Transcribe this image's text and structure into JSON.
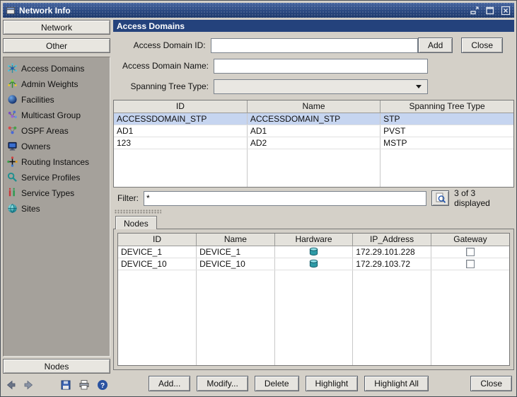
{
  "window": {
    "title": "Network Info"
  },
  "sidebar": {
    "network_button": "Network",
    "other_button": "Other",
    "items": [
      {
        "label": "Access Domains"
      },
      {
        "label": "Admin Weights"
      },
      {
        "label": "Facilities"
      },
      {
        "label": "Multicast Group"
      },
      {
        "label": "OSPF Areas"
      },
      {
        "label": "Owners"
      },
      {
        "label": "Routing Instances"
      },
      {
        "label": "Service Profiles"
      },
      {
        "label": "Service Types"
      },
      {
        "label": "Sites"
      }
    ],
    "nodes_button": "Nodes"
  },
  "header": {
    "title": "Access Domains"
  },
  "form": {
    "id_label": "Access Domain ID:",
    "name_label": "Access Domain Name:",
    "tree_label": "Spanning Tree Type:",
    "id_value": "",
    "name_value": "",
    "tree_value": "",
    "add_button": "Add",
    "close_button": "Close"
  },
  "domains_table": {
    "columns": [
      "ID",
      "Name",
      "Spanning Tree Type"
    ],
    "rows": [
      {
        "id": "ACCESSDOMAIN_STP",
        "name": "ACCESSDOMAIN_STP",
        "tree": "STP"
      },
      {
        "id": "AD1",
        "name": "AD1",
        "tree": "PVST"
      },
      {
        "id": "123",
        "name": "AD2",
        "tree": "MSTP"
      }
    ]
  },
  "filter": {
    "label": "Filter:",
    "value": "*",
    "status": "3 of 3 displayed"
  },
  "nodes": {
    "tab": "Nodes",
    "columns": [
      "ID",
      "Name",
      "Hardware",
      "IP_Address",
      "Gateway"
    ],
    "rows": [
      {
        "id": "DEVICE_1",
        "name": "DEVICE_1",
        "ip": "172.29.101.228"
      },
      {
        "id": "DEVICE_10",
        "name": "DEVICE_10",
        "ip": "172.29.103.72"
      }
    ]
  },
  "footer": {
    "add_button": "Add...",
    "modify_button": "Modify...",
    "delete_button": "Delete",
    "highlight_button": "Highlight",
    "highlight_all_button": "Highlight All",
    "close_button": "Close"
  },
  "icons": {
    "help_glyph": "?"
  },
  "colors": {
    "titlebar": "#2A4880",
    "section_header": "#24427C",
    "selection": "#C6D5F0"
  }
}
